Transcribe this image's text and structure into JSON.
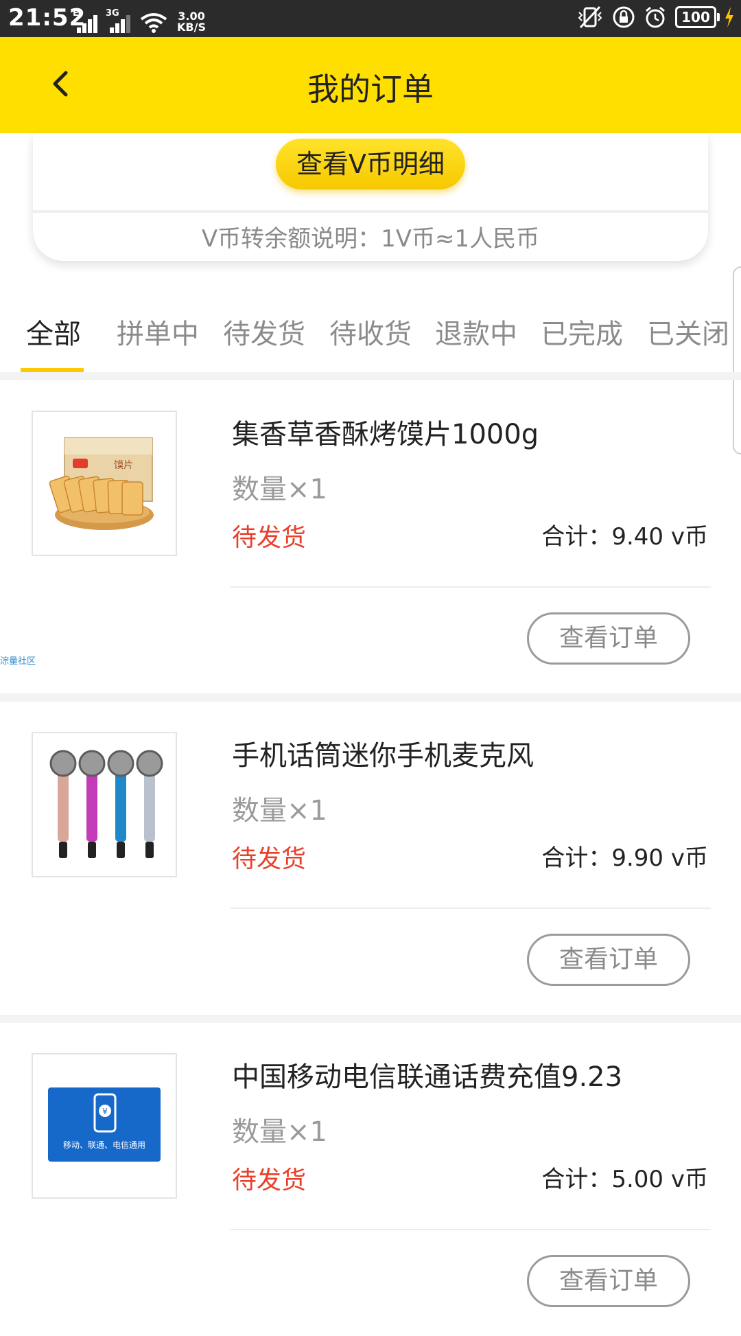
{
  "status_bar": {
    "time": "21:52",
    "network_tag_1": "E",
    "network_tag_2": "3G",
    "speed_value": "3.00",
    "speed_unit": "KB/S",
    "battery": "100"
  },
  "header": {
    "title": "我的订单",
    "back_icon": "chevron-left-icon"
  },
  "vcoin_card": {
    "button_label": "查看V币明细",
    "note": "V币转余额说明：1V币≈1人民币"
  },
  "tabs": [
    "全部",
    "拼单中",
    "待发货",
    "待收货",
    "退款中",
    "已完成",
    "已关闭"
  ],
  "active_tab": 0,
  "watermark": "淙量社区",
  "orders": [
    {
      "name": "集香草香酥烤馍片1000g",
      "qty": "数量×1",
      "status": "待发货",
      "total": "合计：9.40 v币",
      "button": "查看订单",
      "image": "bread-snack"
    },
    {
      "name": "手机话筒迷你手机麦克风",
      "qty": "数量×1",
      "status": "待发货",
      "total": "合计：9.90 v币",
      "button": "查看订单",
      "image": "microphones"
    },
    {
      "name": "中国移动电信联通话费充值9.23",
      "qty": "数量×1",
      "status": "待发货",
      "total": "合计：5.00 v币",
      "button": "查看订单",
      "image": "phone-recharge-card",
      "image_caption": "移动、联通、电信通用",
      "image_symbol": "¥"
    }
  ],
  "colors": {
    "header": "#ffdf00",
    "accent": "#ffc900",
    "status_red": "#e8402a"
  }
}
